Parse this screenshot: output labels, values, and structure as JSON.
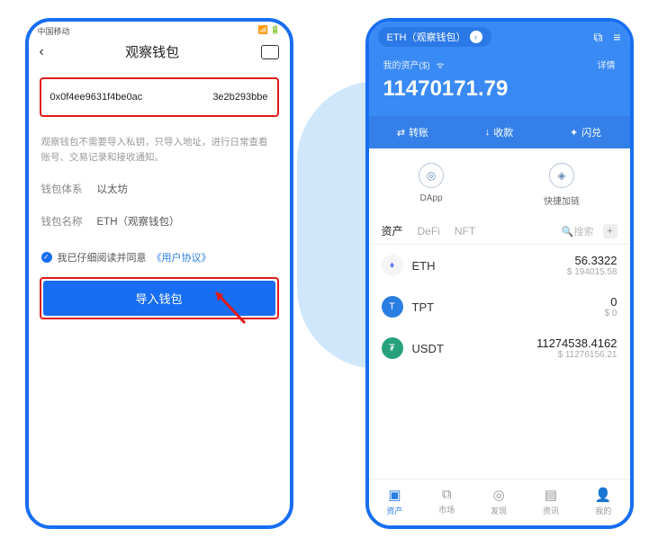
{
  "left": {
    "status": "中国移动",
    "title": "观察钱包",
    "address_prefix": "0x0f4ee9631f4be0ac",
    "address_suffix": "3e2b293bbe",
    "hint": "观察钱包不需要导入私钥，只导入地址，进行日常查看账号、交易记录和接收通知。",
    "chain_label": "钱包体系",
    "chain_value": "以太坊",
    "name_label": "钱包名称",
    "name_value": "ETH（观察钱包）",
    "agree_text": "我已仔细阅读并同意",
    "agree_link": "《用户协议》",
    "import_button": "导入钱包"
  },
  "right": {
    "pill": "ETH（观察钱包）",
    "assets_label": "我的资产($)",
    "detail": "详情",
    "balance": "11470171.79",
    "actions": {
      "transfer": "转账",
      "receive": "收款",
      "swap": "闪兑"
    },
    "quick": {
      "dapp": "DApp",
      "chain": "快捷加链"
    },
    "tabs": {
      "assets": "资产",
      "defi": "DeFi",
      "nft": "NFT",
      "search": "搜索"
    },
    "tokens": [
      {
        "symbol": "ETH",
        "amount": "56.3322",
        "fiat": "$ 194015.58"
      },
      {
        "symbol": "TPT",
        "amount": "0",
        "fiat": "$ 0"
      },
      {
        "symbol": "USDT",
        "amount": "11274538.4162",
        "fiat": "$ 11276156.21"
      }
    ],
    "nav": {
      "assets": "资产",
      "market": "市场",
      "discover": "发现",
      "news": "资讯",
      "me": "我的"
    }
  }
}
